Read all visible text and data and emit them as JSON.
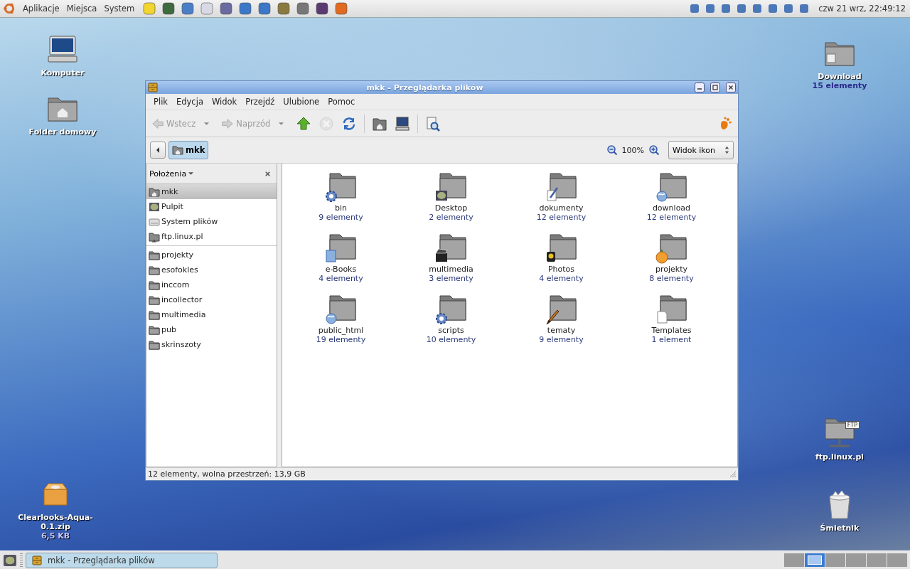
{
  "top_panel": {
    "menus": [
      "Aplikacje",
      "Miejsca",
      "System"
    ],
    "clock": "czw 21 wrz, 22:49:12"
  },
  "desktop_icons": [
    {
      "label": "Komputer",
      "kind": "computer"
    },
    {
      "label": "Folder domowy",
      "kind": "home"
    },
    {
      "label": "Clearlooks-Aqua-0.1.zip",
      "detail": "6,5 KB",
      "kind": "package"
    },
    {
      "label": "Download",
      "detail": "15 elementy",
      "kind": "folder"
    },
    {
      "label": "ftp.linux.pl",
      "kind": "ftp",
      "badge": "FTP"
    },
    {
      "label": "Śmietnik",
      "kind": "trash"
    }
  ],
  "window": {
    "title": "mkk - Przeglądarka plików",
    "menu": [
      "Plik",
      "Edycja",
      "Widok",
      "Przejdź",
      "Ulubione",
      "Pomoc"
    ],
    "toolbar": [
      {
        "kind": "back",
        "label": "Wstecz",
        "disabled": true
      },
      {
        "kind": "forward",
        "label": "Naprzód",
        "disabled": true
      },
      {
        "kind": "up",
        "disabled": false
      },
      {
        "kind": "stop",
        "disabled": true
      },
      {
        "kind": "reload",
        "disabled": false
      },
      {
        "kind": "home",
        "disabled": false
      },
      {
        "kind": "computer",
        "disabled": false
      },
      {
        "kind": "search",
        "disabled": false
      }
    ],
    "location": "mkk",
    "zoom": "100%",
    "view": "Widok ikon",
    "sidebar": {
      "title": "Położenia",
      "places": [
        {
          "label": "mkk",
          "kind": "home",
          "selected": true
        },
        {
          "label": "Pulpit",
          "kind": "desktop",
          "selected": false
        },
        {
          "label": "System plików",
          "kind": "drive",
          "selected": false
        },
        {
          "label": "ftp.linux.pl",
          "kind": "ftp",
          "selected": false
        }
      ],
      "bookmarks": [
        {
          "label": "projekty",
          "selected": false
        },
        {
          "label": "esofokles",
          "selected": false
        },
        {
          "label": "inccom",
          "selected": false
        },
        {
          "label": "incollector",
          "selected": false
        },
        {
          "label": "multimedia",
          "selected": false
        },
        {
          "label": "pub",
          "selected": false
        },
        {
          "label": "skrinszoty",
          "selected": false
        }
      ]
    },
    "files": [
      {
        "name": "bin",
        "count": "9 elementy",
        "kind": "gear"
      },
      {
        "name": "Desktop",
        "count": "2 elementy",
        "kind": "desktop"
      },
      {
        "name": "dokumenty",
        "count": "12 elementy",
        "kind": "document"
      },
      {
        "name": "download",
        "count": "12 elementy",
        "kind": "globe"
      },
      {
        "name": "e-Books",
        "count": "4 elementy",
        "kind": "book"
      },
      {
        "name": "multimedia",
        "count": "3 elementy",
        "kind": "film"
      },
      {
        "name": "Photos",
        "count": "4 elementy",
        "kind": "photo"
      },
      {
        "name": "projekty",
        "count": "8 elementy",
        "kind": "orange"
      },
      {
        "name": "public_html",
        "count": "19 elementy",
        "kind": "globe"
      },
      {
        "name": "scripts",
        "count": "10 elementy",
        "kind": "gear"
      },
      {
        "name": "tematy",
        "count": "9 elementy",
        "kind": "brush"
      },
      {
        "name": "Templates",
        "count": "1 element",
        "kind": "page"
      }
    ],
    "status": "12 elementy, wolna przestrzeń: 13,9 GB"
  },
  "bottom_panel": {
    "task": "mkk - Przeglądarka plików",
    "workspaces": [
      {
        "selected": false
      },
      {
        "selected": true
      },
      {
        "selected": false
      },
      {
        "selected": false
      },
      {
        "selected": false
      },
      {
        "selected": false
      }
    ]
  }
}
